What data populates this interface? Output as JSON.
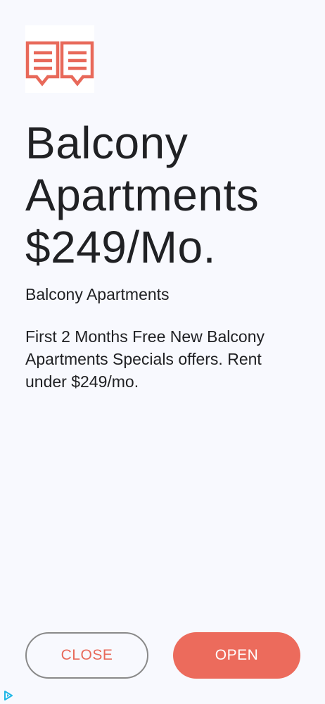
{
  "ad": {
    "headline_lines": [
      "Balcony",
      "Apartments",
      "$249/Mo."
    ],
    "advertiser": "Balcony Apartments",
    "body": "First 2 Months Free New Balcony Apartments Specials offers. Rent under $249/mo.",
    "app_icon": "open-book-icon",
    "adchoices_icon": "adchoices-play-icon"
  },
  "buttons": {
    "close_label": "CLOSE",
    "open_label": "OPEN"
  },
  "colors": {
    "accent": "#ec6b5c",
    "background": "#f8f9fe",
    "text": "#202124",
    "adchoices": "#1fb7e6"
  }
}
